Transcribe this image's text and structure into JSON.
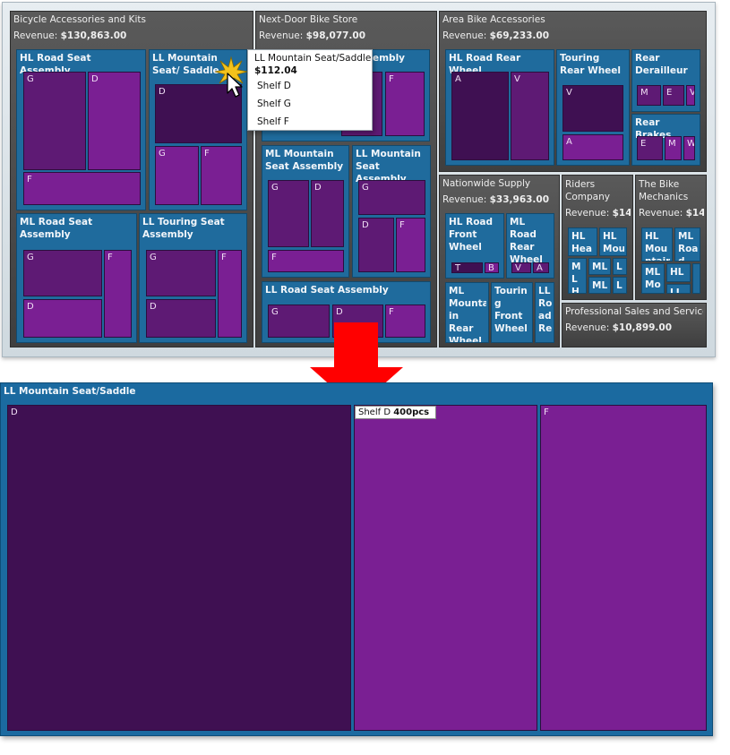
{
  "groups": {
    "bicycle": {
      "name": "Bicycle Accessories and Kits",
      "revenue_label": "Revenue:",
      "revenue": "$130,863.00"
    },
    "nextdoor": {
      "name": "Next-Door Bike Store",
      "revenue_label": "Revenue:",
      "revenue": "$98,077.00"
    },
    "area": {
      "name": "Area Bike Accessories",
      "revenue_label": "Revenue:",
      "revenue": "$69,233.00"
    },
    "nationwide": {
      "name": "Nationwide Supply",
      "revenue_label": "Revenue:",
      "revenue": "$33,963.00"
    },
    "riders": {
      "name": "Riders Company",
      "revenue_label": "Revenue:",
      "revenue": "$14,"
    },
    "mechanics": {
      "name": "The Bike Mechanics",
      "revenue_label": "Revenue:",
      "revenue": "$14"
    },
    "professional": {
      "name": "Professional Sales and Service",
      "revenue_label": "Revenue:",
      "revenue": "$10,899.00"
    }
  },
  "products": {
    "hl_road_seat": "HL Road Seat Assembly",
    "ll_mountain_seat": "LL Mountain Seat/ Saddle",
    "ml_road_seat": "ML Road Seat Assembly",
    "ll_touring_seat": "LL Touring Seat Assembly",
    "nd_hidden": "embly",
    "ml_mountain_seat": "ML Mountain Seat Assembly",
    "ll_mountain_seat_asm": "LL Mountain Seat Assembly",
    "ll_road_seat": "LL Road Seat Assembly",
    "hl_road_rear_wheel": "HL Road Rear Wheel",
    "touring_rear_wheel": "Touring Rear Wheel",
    "rear_derailleur": "Rear Derailleur",
    "rear_brakes": "Rear Brakes",
    "hl_road_front_wheel": "HL Road Front Wheel",
    "ml_road_rear_wheel": "ML Road Rear Wheel",
    "ml_mountain_rear_wheel": "ML Mounta in Rear Wheel",
    "touring_front_wheel": "Tourin g Front Wheel",
    "ll_road_rear": "LL Ro ad Re",
    "riders_hl_hea": "HL Hea",
    "riders_hl_mou": "HL Mou",
    "riders_mlh": "M L H",
    "riders_ml1": "ML",
    "riders_l1": "L",
    "riders_ml2": "ML",
    "riders_l2": "L",
    "mech_hl_mou": "HL Mou ntain",
    "mech_ml_roa": "ML Roa d",
    "mech_ml_mo": "ML Mo",
    "mech_hl": "HL",
    "mech_ll": "LL"
  },
  "shelf_labels": {
    "g": "G",
    "d": "D",
    "f": "F",
    "a": "A",
    "v": "V",
    "m": "M",
    "e": "E",
    "w": "W",
    "t": "T",
    "b": "B"
  },
  "tooltip": {
    "title": "LL Mountain Seat/Saddle",
    "price": "$112.04",
    "items": [
      "Shelf D",
      "Shelf G",
      "Shelf F"
    ]
  },
  "zoom": {
    "title": "LL Mountain Seat/Saddle",
    "shelf_labels": [
      "D",
      "",
      "F"
    ],
    "tip_label": "Shelf D",
    "tip_value": "400pcs"
  },
  "colors": {
    "shelf_dark": "#3f1052",
    "shelf_mid": "#5e1a74",
    "shelf_light": "#7a1f93",
    "product_blue": "#1f6b9d",
    "group_gray": "#4a4a4a",
    "arrow_red": "#ff0000"
  }
}
